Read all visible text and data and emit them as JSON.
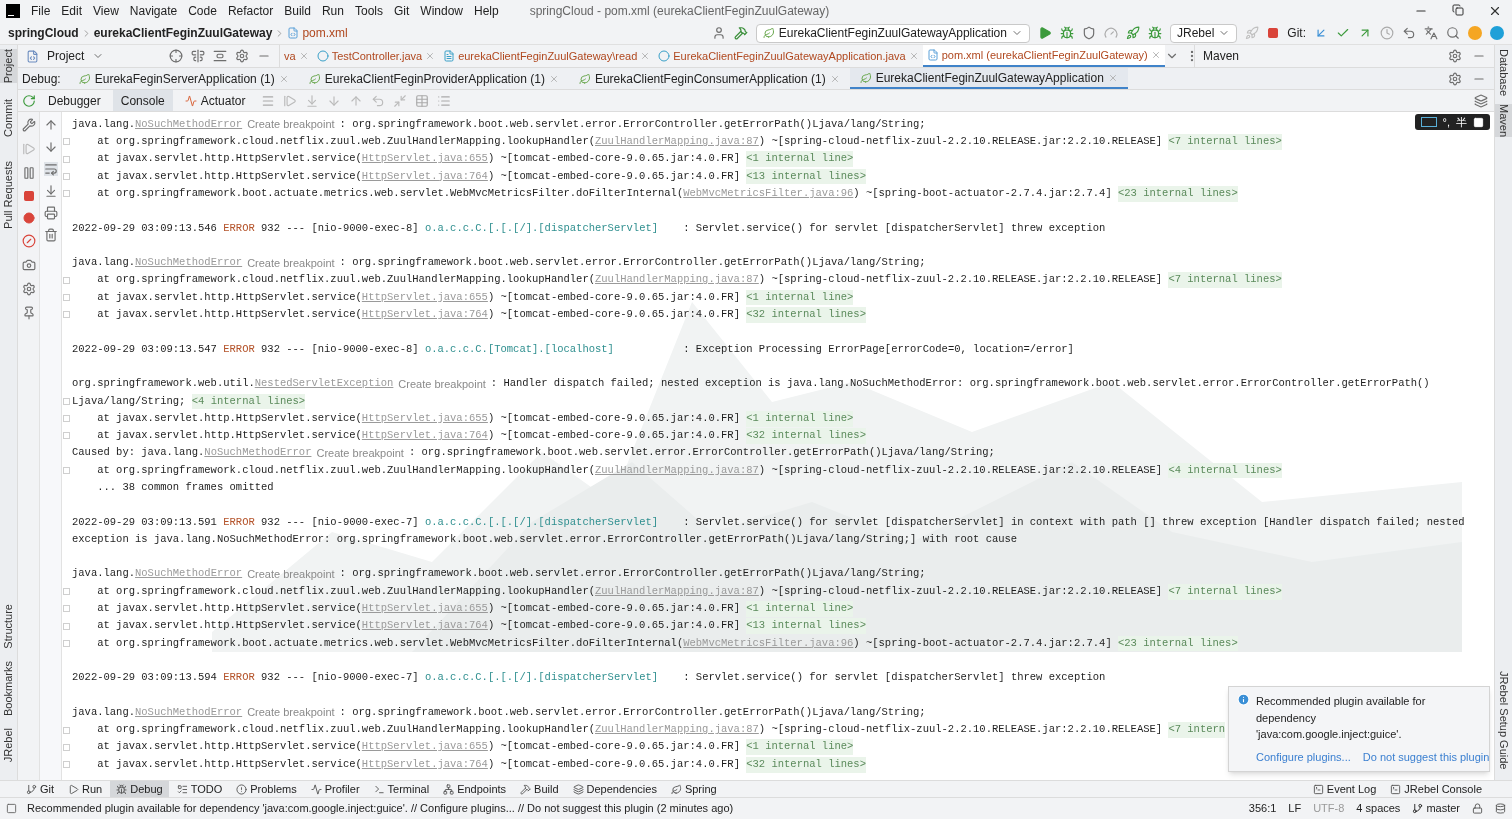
{
  "menu_bar": {
    "items": [
      "File",
      "Edit",
      "View",
      "Navigate",
      "Code",
      "Refactor",
      "Build",
      "Run",
      "Tools",
      "Git",
      "Window",
      "Help"
    ],
    "title": "springCloud - pom.xml (eurekaClientFeginZuulGateway)"
  },
  "breadcrumb": [
    "springCloud",
    "eurekaClientFeginZuulGateway",
    "pom.xml"
  ],
  "toolbar": {
    "run_config": "EurekaClientFeginZuulGatewayApplication",
    "jrebel": "JRebel",
    "git_label": "Git:"
  },
  "project_panel": {
    "title": "Project"
  },
  "editor_tabs": [
    {
      "label": "va",
      "selected": false
    },
    {
      "label": "TestController.java",
      "selected": false
    },
    {
      "label": "eurekaClientFeginZuulGateway\\read",
      "selected": false
    },
    {
      "label": "EurekaClientFeginZuulGatewayApplication.java",
      "selected": false
    },
    {
      "label": "pom.xml (eurekaClientFeginZuulGateway)",
      "selected": true
    }
  ],
  "maven_panel": {
    "title": "Maven"
  },
  "left_stripe": {
    "top": "Project",
    "items": [
      "Commit",
      "Pull Requests"
    ],
    "bottom": [
      "Structure",
      "Bookmarks",
      "JRebel"
    ]
  },
  "right_stripe": {
    "top": [
      "Database",
      "Maven"
    ],
    "bottom": "JRebel Setup Guide"
  },
  "debug": {
    "label": "Debug:",
    "sessions": [
      {
        "label": "EurekaFeginServerApplication (1)",
        "selected": false
      },
      {
        "label": "EurekaClientFeginProviderApplication (1)",
        "selected": false
      },
      {
        "label": "EurekaClientFeginConsumerApplication (1)",
        "selected": false
      },
      {
        "label": "EurekaClientFeginZuulGatewayApplication",
        "selected": true
      }
    ],
    "tabs": [
      {
        "label": "Debugger",
        "selected": false
      },
      {
        "label": "Console",
        "selected": true
      },
      {
        "label": "Actuator",
        "selected": false
      }
    ]
  },
  "ime_indicator": {
    "punctuation": "°,",
    "width": "半"
  },
  "console": {
    "lines": [
      {
        "fold": false,
        "segments": [
          {
            "kind": "text",
            "text": "java.lang."
          },
          {
            "kind": "link",
            "text": "NoSuchMethodError"
          },
          {
            "kind": "hint",
            "text": "Create breakpoint"
          },
          {
            "kind": "text",
            "text": ": org.springframework.boot.web.servlet.error.ErrorController.getErrorPath()Ljava/lang/String;"
          }
        ]
      },
      {
        "fold": true,
        "segments": [
          {
            "kind": "text",
            "text": "    at org.springframework.cloud.netflix.zuul.web.ZuulHandlerMapping.lookupHandler("
          },
          {
            "kind": "link",
            "text": "ZuulHandlerMapping.java:87"
          },
          {
            "kind": "text",
            "text": ") ~[spring-cloud-netflix-zuul-2.2.10.RELEASE.jar:2.2.10.RELEASE] "
          },
          {
            "kind": "folded",
            "text": "<7 internal lines>"
          }
        ]
      },
      {
        "fold": true,
        "segments": [
          {
            "kind": "text",
            "text": "    at javax.servlet.http.HttpServlet.service("
          },
          {
            "kind": "link",
            "text": "HttpServlet.java:655"
          },
          {
            "kind": "text",
            "text": ") ~[tomcat-embed-core-9.0.65.jar:4.0.FR] "
          },
          {
            "kind": "folded",
            "text": "<1 internal line>"
          }
        ]
      },
      {
        "fold": true,
        "segments": [
          {
            "kind": "text",
            "text": "    at javax.servlet.http.HttpServlet.service("
          },
          {
            "kind": "link",
            "text": "HttpServlet.java:764"
          },
          {
            "kind": "text",
            "text": ") ~[tomcat-embed-core-9.0.65.jar:4.0.FR] "
          },
          {
            "kind": "folded",
            "text": "<13 internal lines>"
          }
        ]
      },
      {
        "fold": true,
        "segments": [
          {
            "kind": "text",
            "text": "    at org.springframework.boot.actuate.metrics.web.servlet.WebMvcMetricsFilter.doFilterInternal("
          },
          {
            "kind": "link",
            "text": "WebMvcMetricsFilter.java:96"
          },
          {
            "kind": "text",
            "text": ") ~[spring-boot-actuator-2.7.4.jar:2.7.4] "
          },
          {
            "kind": "folded",
            "text": "<23 internal lines>"
          }
        ]
      },
      {
        "fold": false
      },
      {
        "fold": false,
        "segments": [
          {
            "kind": "text",
            "text": "2022-09-29 03:09:13.546 "
          },
          {
            "kind": "error",
            "text": "ERROR"
          },
          {
            "kind": "text",
            "text": " 932 --- [nio-9000-exec-8] "
          },
          {
            "kind": "logger",
            "text": "o.a.c.c.C.[.[.[/].[dispatcherServlet]"
          },
          {
            "kind": "text",
            "text": "    : Servlet.service() for servlet [dispatcherServlet] threw exception"
          }
        ]
      },
      {
        "fold": false
      },
      {
        "fold": false,
        "segments": [
          {
            "kind": "text",
            "text": "java.lang."
          },
          {
            "kind": "link",
            "text": "NoSuchMethodError"
          },
          {
            "kind": "hint",
            "text": "Create breakpoint"
          },
          {
            "kind": "text",
            "text": ": org.springframework.boot.web.servlet.error.ErrorController.getErrorPath()Ljava/lang/String;"
          }
        ]
      },
      {
        "fold": true,
        "segments": [
          {
            "kind": "text",
            "text": "    at org.springframework.cloud.netflix.zuul.web.ZuulHandlerMapping.lookupHandler("
          },
          {
            "kind": "link",
            "text": "ZuulHandlerMapping.java:87"
          },
          {
            "kind": "text",
            "text": ") ~[spring-cloud-netflix-zuul-2.2.10.RELEASE.jar:2.2.10.RELEASE] "
          },
          {
            "kind": "folded",
            "text": "<7 internal lines>"
          }
        ]
      },
      {
        "fold": true,
        "segments": [
          {
            "kind": "text",
            "text": "    at javax.servlet.http.HttpServlet.service("
          },
          {
            "kind": "link",
            "text": "HttpServlet.java:655"
          },
          {
            "kind": "text",
            "text": ") ~[tomcat-embed-core-9.0.65.jar:4.0.FR] "
          },
          {
            "kind": "folded",
            "text": "<1 internal line>"
          }
        ]
      },
      {
        "fold": true,
        "segments": [
          {
            "kind": "text",
            "text": "    at javax.servlet.http.HttpServlet.service("
          },
          {
            "kind": "link",
            "text": "HttpServlet.java:764"
          },
          {
            "kind": "text",
            "text": ") ~[tomcat-embed-core-9.0.65.jar:4.0.FR] "
          },
          {
            "kind": "folded",
            "text": "<32 internal lines>"
          }
        ]
      },
      {
        "fold": false
      },
      {
        "fold": false,
        "segments": [
          {
            "kind": "text",
            "text": "2022-09-29 03:09:13.547 "
          },
          {
            "kind": "error",
            "text": "ERROR"
          },
          {
            "kind": "text",
            "text": " 932 --- [nio-9000-exec-8] "
          },
          {
            "kind": "logger",
            "text": "o.a.c.c.C.[Tomcat].[localhost]"
          },
          {
            "kind": "text",
            "text": "           : Exception Processing ErrorPage[errorCode=0, location=/error]"
          }
        ]
      },
      {
        "fold": false
      },
      {
        "fold": false,
        "segments": [
          {
            "kind": "text",
            "text": "org.springframework.web.util."
          },
          {
            "kind": "link",
            "text": "NestedServletException"
          },
          {
            "kind": "hint",
            "text": "Create breakpoint"
          },
          {
            "kind": "text",
            "text": ": Handler dispatch failed; nested exception is java.lang.NoSuchMethodError: org.springframework.boot.web.servlet.error.ErrorController.getErrorPath()"
          }
        ]
      },
      {
        "fold": true,
        "segments": [
          {
            "kind": "text",
            "text": "Ljava/lang/String; "
          },
          {
            "kind": "folded",
            "text": "<4 internal lines>"
          }
        ]
      },
      {
        "fold": true,
        "segments": [
          {
            "kind": "text",
            "text": "    at javax.servlet.http.HttpServlet.service("
          },
          {
            "kind": "link",
            "text": "HttpServlet.java:655"
          },
          {
            "kind": "text",
            "text": ") ~[tomcat-embed-core-9.0.65.jar:4.0.FR] "
          },
          {
            "kind": "folded",
            "text": "<1 internal line>"
          }
        ]
      },
      {
        "fold": true,
        "segments": [
          {
            "kind": "text",
            "text": "    at javax.servlet.http.HttpServlet.service("
          },
          {
            "kind": "link",
            "text": "HttpServlet.java:764"
          },
          {
            "kind": "text",
            "text": ") ~[tomcat-embed-core-9.0.65.jar:4.0.FR] "
          },
          {
            "kind": "folded",
            "text": "<32 internal lines>"
          }
        ]
      },
      {
        "fold": false,
        "segments": [
          {
            "kind": "text",
            "text": "Caused by: java.lang."
          },
          {
            "kind": "link",
            "text": "NoSuchMethodError"
          },
          {
            "kind": "hint",
            "text": "Create breakpoint"
          },
          {
            "kind": "text",
            "text": ": org.springframework.boot.web.servlet.error.ErrorController.getErrorPath()Ljava/lang/String;"
          }
        ]
      },
      {
        "fold": true,
        "segments": [
          {
            "kind": "text",
            "text": "    at org.springframework.cloud.netflix.zuul.web.ZuulHandlerMapping.lookupHandler("
          },
          {
            "kind": "link",
            "text": "ZuulHandlerMapping.java:87"
          },
          {
            "kind": "text",
            "text": ") ~[spring-cloud-netflix-zuul-2.2.10.RELEASE.jar:2.2.10.RELEASE] "
          },
          {
            "kind": "folded",
            "text": "<4 internal lines>"
          }
        ]
      },
      {
        "fold": false,
        "segments": [
          {
            "kind": "text",
            "text": "    ... 38 common frames omitted"
          }
        ]
      },
      {
        "fold": false
      },
      {
        "fold": false,
        "segments": [
          {
            "kind": "text",
            "text": "2022-09-29 03:09:13.591 "
          },
          {
            "kind": "error",
            "text": "ERROR"
          },
          {
            "kind": "text",
            "text": " 932 --- [nio-9000-exec-7] "
          },
          {
            "kind": "logger",
            "text": "o.a.c.c.C.[.[.[/].[dispatcherServlet]"
          },
          {
            "kind": "text",
            "text": "    : Servlet.service() for servlet [dispatcherServlet] in context with path [] threw exception [Handler dispatch failed; nested"
          }
        ]
      },
      {
        "fold": false,
        "segments": [
          {
            "kind": "text",
            "text": "exception is java.lang.NoSuchMethodError: org.springframework.boot.web.servlet.error.ErrorController.getErrorPath()Ljava/lang/String;] with root cause"
          }
        ]
      },
      {
        "fold": false
      },
      {
        "fold": false,
        "segments": [
          {
            "kind": "text",
            "text": "java.lang."
          },
          {
            "kind": "link",
            "text": "NoSuchMethodError"
          },
          {
            "kind": "hint",
            "text": "Create breakpoint"
          },
          {
            "kind": "text",
            "text": ": org.springframework.boot.web.servlet.error.ErrorController.getErrorPath()Ljava/lang/String;"
          }
        ]
      },
      {
        "fold": true,
        "segments": [
          {
            "kind": "text",
            "text": "    at org.springframework.cloud.netflix.zuul.web.ZuulHandlerMapping.lookupHandler("
          },
          {
            "kind": "link",
            "text": "ZuulHandlerMapping.java:87"
          },
          {
            "kind": "text",
            "text": ") ~[spring-cloud-netflix-zuul-2.2.10.RELEASE.jar:2.2.10.RELEASE] "
          },
          {
            "kind": "folded",
            "text": "<7 internal lines>"
          }
        ]
      },
      {
        "fold": true,
        "segments": [
          {
            "kind": "text",
            "text": "    at javax.servlet.http.HttpServlet.service("
          },
          {
            "kind": "link",
            "text": "HttpServlet.java:655"
          },
          {
            "kind": "text",
            "text": ") ~[tomcat-embed-core-9.0.65.jar:4.0.FR] "
          },
          {
            "kind": "folded",
            "text": "<1 internal line>"
          }
        ]
      },
      {
        "fold": true,
        "segments": [
          {
            "kind": "text",
            "text": "    at javax.servlet.http.HttpServlet.service("
          },
          {
            "kind": "link",
            "text": "HttpServlet.java:764"
          },
          {
            "kind": "text",
            "text": ") ~[tomcat-embed-core-9.0.65.jar:4.0.FR] "
          },
          {
            "kind": "folded",
            "text": "<13 internal lines>"
          }
        ]
      },
      {
        "fold": true,
        "segments": [
          {
            "kind": "text",
            "text": "    at org.springframework.boot.actuate.metrics.web.servlet.WebMvcMetricsFilter.doFilterInternal("
          },
          {
            "kind": "link",
            "text": "WebMvcMetricsFilter.java:96"
          },
          {
            "kind": "text",
            "text": ") ~[spring-boot-actuator-2.7.4.jar:2.7.4] "
          },
          {
            "kind": "folded",
            "text": "<23 internal lines>"
          }
        ]
      },
      {
        "fold": false
      },
      {
        "fold": false,
        "segments": [
          {
            "kind": "text",
            "text": "2022-09-29 03:09:13.594 "
          },
          {
            "kind": "error",
            "text": "ERROR"
          },
          {
            "kind": "text",
            "text": " 932 --- [nio-9000-exec-7] "
          },
          {
            "kind": "logger",
            "text": "o.a.c.c.C.[.[.[/].[dispatcherServlet]"
          },
          {
            "kind": "text",
            "text": "    : Servlet.service() for servlet [dispatcherServlet] threw exception"
          }
        ]
      },
      {
        "fold": false
      },
      {
        "fold": false,
        "segments": [
          {
            "kind": "text",
            "text": "java.lang."
          },
          {
            "kind": "link",
            "text": "NoSuchMethodError"
          },
          {
            "kind": "hint",
            "text": "Create breakpoint"
          },
          {
            "kind": "text",
            "text": ": org.springframework.boot.web.servlet.error.ErrorController.getErrorPath()Ljava/lang/String;"
          }
        ]
      },
      {
        "fold": true,
        "segments": [
          {
            "kind": "text",
            "text": "    at org.springframework.cloud.netflix.zuul.web.ZuulHandlerMapping.lookupHandler("
          },
          {
            "kind": "link",
            "text": "ZuulHandlerMapping.java:87"
          },
          {
            "kind": "text",
            "text": ") ~[spring-cloud-netflix-zuul-2.2.10.RELEASE.jar:2.2.10.RELEASE] "
          },
          {
            "kind": "folded",
            "text": "<7 intern"
          }
        ]
      },
      {
        "fold": true,
        "segments": [
          {
            "kind": "text",
            "text": "    at javax.servlet.http.HttpServlet.service("
          },
          {
            "kind": "link",
            "text": "HttpServlet.java:655"
          },
          {
            "kind": "text",
            "text": ") ~[tomcat-embed-core-9.0.65.jar:4.0.FR] "
          },
          {
            "kind": "folded",
            "text": "<1 internal line>"
          }
        ]
      },
      {
        "fold": true,
        "segments": [
          {
            "kind": "text",
            "text": "    at javax.servlet.http.HttpServlet.service("
          },
          {
            "kind": "link",
            "text": "HttpServlet.java:764"
          },
          {
            "kind": "text",
            "text": ") ~[tomcat-embed-core-9.0.65.jar:4.0.FR] "
          },
          {
            "kind": "folded",
            "text": "<32 internal lines>"
          }
        ]
      }
    ]
  },
  "notification": {
    "message": "Recommended plugin available for dependency 'java:com.google.inject:guice'.",
    "actions": [
      "Configure plugins...",
      "Do not suggest this plugin"
    ]
  },
  "tool_windows": [
    {
      "label": "Git",
      "selected": false
    },
    {
      "label": "Run",
      "selected": false
    },
    {
      "label": "Debug",
      "selected": true
    },
    {
      "label": "TODO",
      "selected": false
    },
    {
      "label": "Problems",
      "selected": false
    },
    {
      "label": "Profiler",
      "selected": false
    },
    {
      "label": "Terminal",
      "selected": false
    },
    {
      "label": "Endpoints",
      "selected": false
    },
    {
      "label": "Build",
      "selected": false
    },
    {
      "label": "Dependencies",
      "selected": false
    },
    {
      "label": "Spring",
      "selected": false
    }
  ],
  "tool_windows_right": [
    "Event Log",
    "JRebel Console"
  ],
  "status_bar": {
    "message": "Recommended plugin available for dependency 'java:com.google.inject:guice'. // Configure plugins... // Do not suggest this plugin (2 minutes ago)",
    "position": "356:1",
    "line_separator": "LF",
    "encoding": "UTF-8",
    "indent": "4 spaces",
    "branch": "master"
  }
}
